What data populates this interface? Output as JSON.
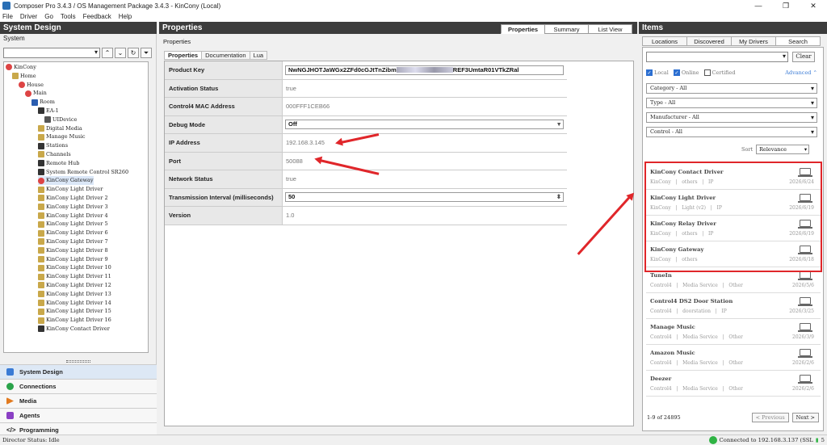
{
  "window": {
    "title": "Composer Pro 3.4.3 / OS Management Package 3.4.3 - KinCony (Local)"
  },
  "menu": [
    "File",
    "Driver",
    "Go",
    "Tools",
    "Feedback",
    "Help"
  ],
  "left": {
    "title": "System Design",
    "subtitle": "System",
    "tree": [
      {
        "label": "KinCony",
        "icon": "red"
      },
      {
        "label": "Home",
        "icon": "house"
      },
      {
        "label": "House",
        "icon": "red"
      },
      {
        "label": "Main",
        "icon": "red"
      },
      {
        "label": "Room",
        "icon": "blue"
      },
      {
        "label": "EA-1",
        "icon": "dark"
      },
      {
        "label": "UIDevice",
        "icon": "mon"
      },
      {
        "label": "Digital Media",
        "icon": "house"
      },
      {
        "label": "Manage Music",
        "icon": "house"
      },
      {
        "label": "Stations",
        "icon": "dark"
      },
      {
        "label": "Channels",
        "icon": "house"
      },
      {
        "label": "Remote Hub",
        "icon": "dark"
      },
      {
        "label": "System Remote Control SR260",
        "icon": "dark"
      },
      {
        "label": "KinCony Gateway",
        "icon": "red"
      },
      {
        "label": "KinCony Light Driver",
        "icon": "house"
      },
      {
        "label": "KinCony Light Driver 2",
        "icon": "house"
      },
      {
        "label": "KinCony Light Driver 3",
        "icon": "house"
      },
      {
        "label": "KinCony Light Driver 4",
        "icon": "house"
      },
      {
        "label": "KinCony Light Driver 5",
        "icon": "house"
      },
      {
        "label": "KinCony Light Driver 6",
        "icon": "house"
      },
      {
        "label": "KinCony Light Driver 7",
        "icon": "house"
      },
      {
        "label": "KinCony Light Driver 8",
        "icon": "house"
      },
      {
        "label": "KinCony Light Driver 9",
        "icon": "house"
      },
      {
        "label": "KinCony Light Driver 10",
        "icon": "house"
      },
      {
        "label": "KinCony Light Driver 11",
        "icon": "house"
      },
      {
        "label": "KinCony Light Driver 12",
        "icon": "house"
      },
      {
        "label": "KinCony Light Driver 13",
        "icon": "house"
      },
      {
        "label": "KinCony Light Driver 14",
        "icon": "house"
      },
      {
        "label": "KinCony Light Driver 15",
        "icon": "house"
      },
      {
        "label": "KinCony Light Driver 16",
        "icon": "house"
      },
      {
        "label": "KinCony Contact Driver",
        "icon": "dark"
      }
    ],
    "nav": [
      "System Design",
      "Connections",
      "Media",
      "Agents",
      "Programming"
    ]
  },
  "mid": {
    "title": "Properties",
    "tabs": [
      "Properties",
      "Summary",
      "List View"
    ],
    "section": "Properties",
    "subtabs": [
      "Properties",
      "Documentation",
      "Lua"
    ],
    "rows": [
      {
        "key": "Product Key",
        "value": "NwNGJHOTJaWGx2ZFd0cGJtTnZibm",
        "value_tail": "REF3UmtaR01VTkZRal"
      },
      {
        "key": "Activation Status",
        "value": "true"
      },
      {
        "key": "Control4 MAC Address",
        "value": "000FFF1CEB66"
      },
      {
        "key": "Debug Mode",
        "value": "Off"
      },
      {
        "key": "IP Address",
        "value": "192.168.3.145"
      },
      {
        "key": "Port",
        "value": "50088"
      },
      {
        "key": "Network Status",
        "value": "true"
      },
      {
        "key": "Transmission Interval (milliseconds)",
        "value": "50"
      },
      {
        "key": "Version",
        "value": "1.0"
      }
    ]
  },
  "right": {
    "title": "Items",
    "tabs": [
      "Locations",
      "Discovered",
      "My Drivers",
      "Search"
    ],
    "clear": "Clear",
    "checks": [
      {
        "label": "Local",
        "checked": true
      },
      {
        "label": "Online",
        "checked": true
      },
      {
        "label": "Certified",
        "checked": false
      }
    ],
    "advanced": "Advanced",
    "filters": [
      "Category - All",
      "Type - All",
      "Manufacturer - All",
      "Control - All"
    ],
    "sort_label": "Sort",
    "sort_value": "Relevance",
    "items": [
      {
        "name": "KinCony Contact Driver",
        "meta": "KinCony   |   others   |   IP",
        "date": "2026/6/24"
      },
      {
        "name": "KinCony Light Driver",
        "meta": "KinCony   |   Light (v2)   |   IP",
        "date": "2026/6/19"
      },
      {
        "name": "KinCony Relay Driver",
        "meta": "KinCony   |   others   |   IP",
        "date": "2026/6/19"
      },
      {
        "name": "KinCony Gateway",
        "meta": "KinCony   |   others",
        "date": "2026/6/18"
      },
      {
        "name": "TuneIn",
        "meta": "Control4   |   Media Service   |   Other",
        "date": "2026/5/6"
      },
      {
        "name": "Control4 DS2 Door Station",
        "meta": "Control4   |   doorstation   |   IP",
        "date": "2026/3/25"
      },
      {
        "name": "Manage Music",
        "meta": "Control4   |   Media Service   |   Other",
        "date": "2026/3/9"
      },
      {
        "name": "Amazon Music",
        "meta": "Control4   |   Media Service   |   Other",
        "date": "2026/2/6"
      },
      {
        "name": "Deezer",
        "meta": "Control4   |   Media Service   |   Other",
        "date": "2026/2/6"
      }
    ],
    "count": "1-9 of 24895",
    "prev": "< Previous",
    "next": "Next >"
  },
  "status": {
    "director": "Director Status: Idle",
    "connected": "Connected to 192.168.3.137 (SSL",
    "tail": "5"
  },
  "colors": {
    "accent": "#e0262a",
    "header": "#3c3c3c",
    "online": "#2fb344"
  }
}
